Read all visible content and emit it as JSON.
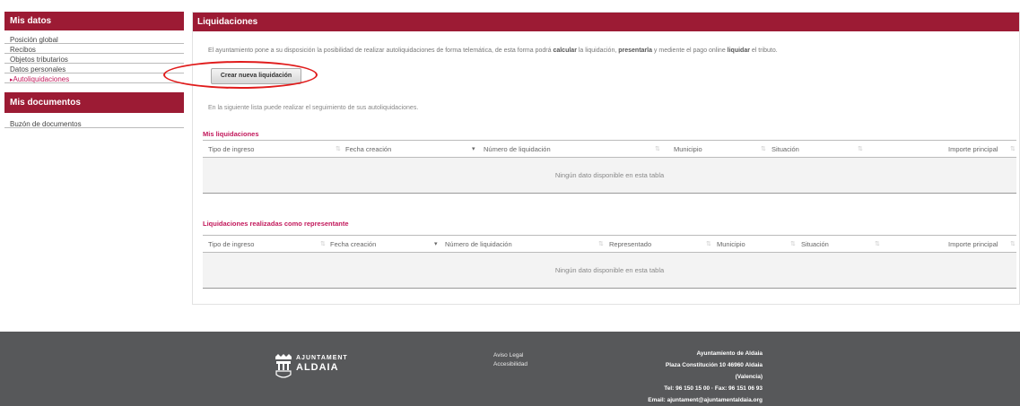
{
  "sidebar": {
    "mis_datos_title": "Mis datos",
    "items": [
      {
        "label": "Posición global"
      },
      {
        "label": "Recibos"
      },
      {
        "label": "Objetos tributarios"
      },
      {
        "label": "Datos personales"
      },
      {
        "label": "Autoliquidaciones"
      }
    ],
    "mis_documentos_title": "Mis documentos",
    "doc_items": [
      {
        "label": "Buzón de documentos"
      }
    ]
  },
  "main": {
    "title": "Liquidaciones",
    "intro_1": "El ayuntamiento pone a su disposición la posibilidad de realizar autoliquidaciones de forma telemática, de esta forma podrá ",
    "intro_calcular": "calcular",
    "intro_2": " la liquidación, ",
    "intro_presentarla": "presentarla",
    "intro_3": " y mediente el pago online ",
    "intro_liquidar": "liquidar",
    "intro_4": " el tributo.",
    "create_button": "Crear nueva liquidación",
    "seguimiento": "En la siguiente lista puede realizar el seguimiento de sus autoliquidaciones.",
    "mis_liquidaciones": {
      "title": "Mis liquidaciones",
      "columns": [
        "Tipo de ingreso",
        "Fecha creación",
        "Número de liquidación",
        "Municipio",
        "Situación",
        "Importe principal"
      ],
      "empty": "Ningún dato disponible en esta tabla"
    },
    "representante": {
      "title": "Liquidaciones realizadas como representante",
      "columns": [
        "Tipo de ingreso",
        "Fecha creación",
        "Número de liquidación",
        "Representado",
        "Municipio",
        "Situación",
        "Importe principal"
      ],
      "empty": "Ningún dato disponible en esta tabla"
    }
  },
  "footer": {
    "logo_line1": "AJUNTAMENT",
    "logo_line2": "ALDAIA",
    "aviso_legal": "Aviso Legal",
    "accesibilidad": "Accesibilidad",
    "org_name": "Ayuntamiento de Aldaia",
    "address": "Plaza Constitución 10 46960 Aldaia",
    "region": "(Valencia)",
    "phone": "Tel: 96 150 15 00 · Fax: 96 151 06 93",
    "email": "Email: ajuntament@ajuntamentaldaia.org"
  },
  "colors": {
    "brand": "#9c1b34",
    "accent": "#c2185b",
    "footer_bg": "#57585a",
    "highlight": "#e01b1b"
  }
}
